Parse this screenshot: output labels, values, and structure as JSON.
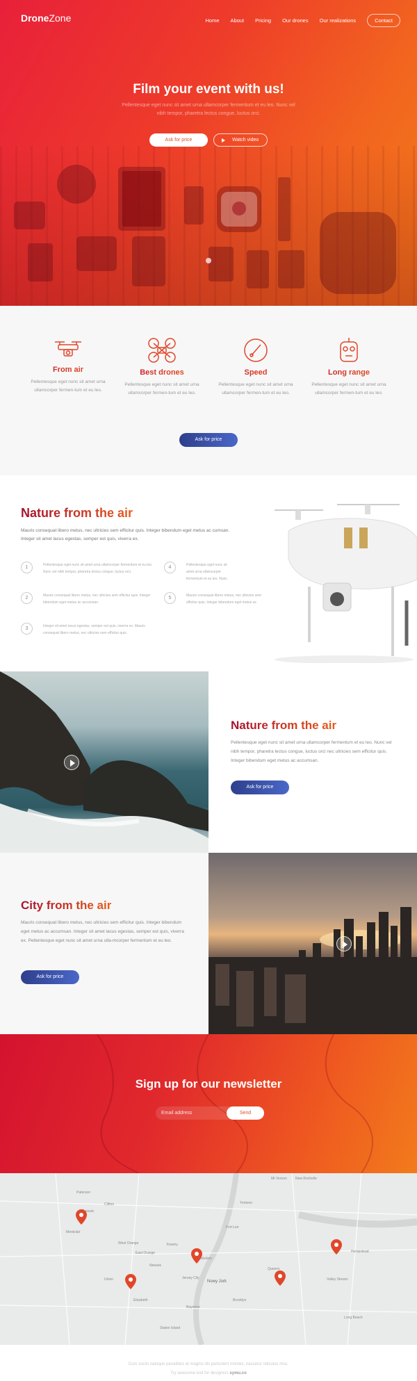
{
  "header": {
    "logo_bold": "Drone",
    "logo_light": "Zone",
    "nav": [
      "Home",
      "About",
      "Pricing",
      "Our drones",
      "Our realizations",
      "Contact"
    ]
  },
  "hero": {
    "title": "Film your event with us!",
    "subtitle": "Pellentesque eget nunc sit amet urna ullamcorper fermentum et eu leo. Nunc vel nibh tempor, pharetra lectus congue, luctus orci.",
    "primary_button": "Ask for price",
    "video_button": "Watch video"
  },
  "features": {
    "items": [
      {
        "title": "From air",
        "text": "Pellentesque eget nunc sit amet urna ullamcorper fermen-tum et eu leo.",
        "icon": "drone-camera-icon"
      },
      {
        "title": "Best drones",
        "text": "Pellentesque eget nunc sit amet urna ullamcorper fermen-tum et eu leo.",
        "icon": "quadcopter-icon"
      },
      {
        "title": "Speed",
        "text": "Pellentesque eget nunc sit amet urna ullamcorper fermen-tum et eu leo.",
        "icon": "speedometer-icon"
      },
      {
        "title": "Long range",
        "text": "Pellentesque eget nunc sit amet urna ullamcorper fermen-tum et eu leo.",
        "icon": "remote-control-icon"
      }
    ],
    "button": "Ask for price"
  },
  "nature_steps": {
    "title": "Nature from the air",
    "intro": "Mauris consequat libero metus, nec ultricies sem efficitur quis. Integer bibendum eget metus ac cumsan. Integer sit amet lacus egestas, semper est quis, viverra ex.",
    "steps": [
      {
        "num": "1",
        "text": "Pellentesque eget nunc sit amet urna ullamcorper fermentum et eu leo. Nunc vel nibh tempor, pharetra lectus congue, luctus orci."
      },
      {
        "num": "2",
        "text": "Mauris consequat libero metus, nec ultricies sem efficitur quis. Integer bibendum eget metus ac accumsan."
      },
      {
        "num": "3",
        "text": "Integer sit amet lacus egestas, semper est quis, viverra ex. Mauris consequat libero metus, nec ultricies sem efficitur quis."
      },
      {
        "num": "4",
        "text": "Pellentesque eget nunc sit amet urna ullamcorper fermentum et eu leo. Nunc vel nibh tempor, pharetra lectus congue, luctus orci."
      },
      {
        "num": "5",
        "text": "Mauris consequat libero metus, nec ultricies sem efficitur quis. Integer bibendum eget metus ac accumsan."
      }
    ]
  },
  "nature_video": {
    "title": "Nature from the air",
    "text": "Pellentesque eget nunc sit amet urna ullamcorper fermentum et eu leo. Nunc vel nibh tempor, pharetra lectus congue, luctus orci nec ultricies sem efficitur quis. Integer bibendum eget metus ac accumsan.",
    "button": "Ask for price"
  },
  "city": {
    "title": "City from the air",
    "text": "Mauris consequat libero metus, nec ultricies sem efficitur quis. Integer bibendum eget metus ac accumsan. Integer sit amet lacus egestas, semper est quis, viverra ex. Pellentesque eget nunc sit amet urna ulla-mcorper fermentum et eu leo.",
    "button": "Ask for price"
  },
  "newsletter": {
    "title": "Sign up for our newsletter",
    "email_placeholder": "Email address",
    "send_button": "Send"
  },
  "map": {
    "labels": [
      "Mt Vernon",
      "New Rochelle",
      "Paterson",
      "Clifton",
      "Passaic",
      "Montclair",
      "West Orange",
      "Newark",
      "East Orange",
      "Jersey City",
      "Nowy Jork",
      "Elizabeth",
      "Union",
      "Kearny",
      "Hoboken",
      "Queens",
      "Brooklyn",
      "Bayonne",
      "Staten Island",
      "Yonkers",
      "Fort Lee",
      "Hempstead",
      "Valley Stream",
      "Long Beach"
    ],
    "pin_color": "#e0472a"
  },
  "footer": {
    "line1": "Cum sociis natoque penatibus et magnis dis parturient montes, nascetur ridiculus mus.",
    "line2_prefix": "Try awesome tool for designers",
    "line2_brand": "symu.co"
  },
  "colors": {
    "accent_red": "#d4122f",
    "accent_orange": "#f27b1c",
    "button_blue": "#3a52b0"
  }
}
